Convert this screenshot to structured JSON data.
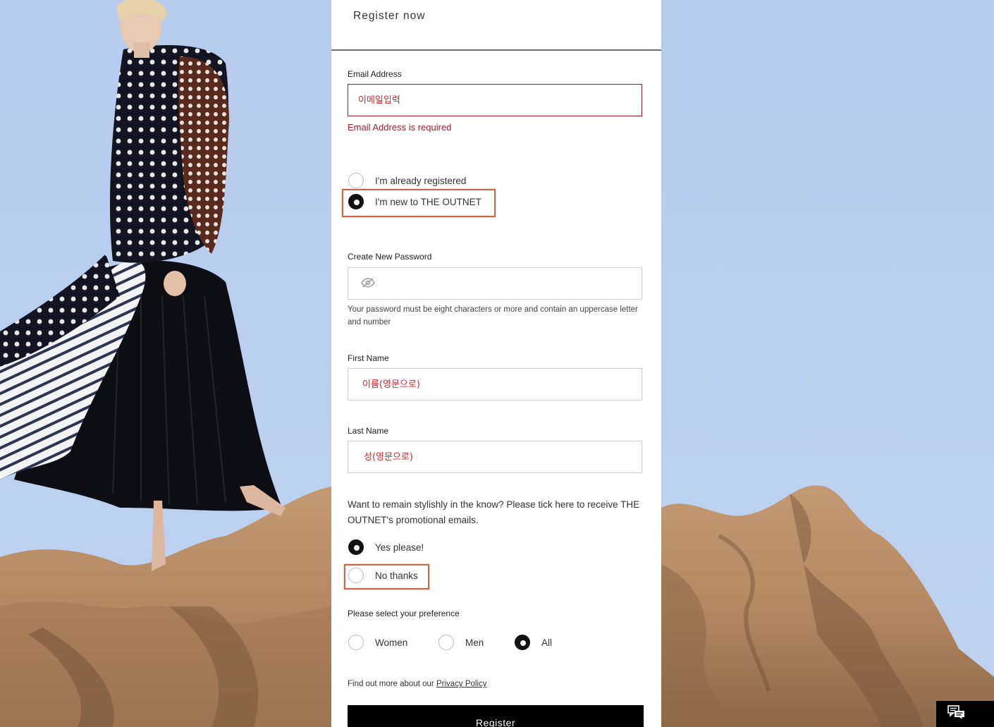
{
  "page": {
    "title": "Register now"
  },
  "email": {
    "label": "Email Address",
    "placeholder": "이메일입력",
    "error": "Email Address is required"
  },
  "account_type": {
    "options": [
      {
        "label": "I'm already registered",
        "selected": false
      },
      {
        "label": "I'm new to THE OUTNET",
        "selected": true
      }
    ]
  },
  "password": {
    "label": "Create New Password",
    "icon": "eye-hidden-icon",
    "help": "Your password must be eight characters or more and contain an uppercase letter and number"
  },
  "first_name": {
    "label": "First Name",
    "placeholder": "이름(영문으로)"
  },
  "last_name": {
    "label": "Last Name",
    "placeholder": "성(영문으로)"
  },
  "promo": {
    "text": "Want to remain stylishly in the know? Please tick here to receive THE OUTNET's promotional emails.",
    "options": [
      {
        "label": "Yes please!",
        "selected": true
      },
      {
        "label": "No thanks",
        "selected": false
      }
    ]
  },
  "preference": {
    "label": "Please select your preference",
    "options": [
      {
        "label": "Women",
        "selected": false
      },
      {
        "label": "Men",
        "selected": false
      },
      {
        "label": "All",
        "selected": true
      }
    ]
  },
  "privacy": {
    "text": "Find out more about our ",
    "link": "Privacy Policy"
  },
  "register_button": "Register",
  "chat": {
    "icon": "chat-bubbles-icon"
  },
  "colors": {
    "error": "#a3202a",
    "highlight": "#c66a4b",
    "button": "#000000",
    "sky": "#b9cdee"
  }
}
